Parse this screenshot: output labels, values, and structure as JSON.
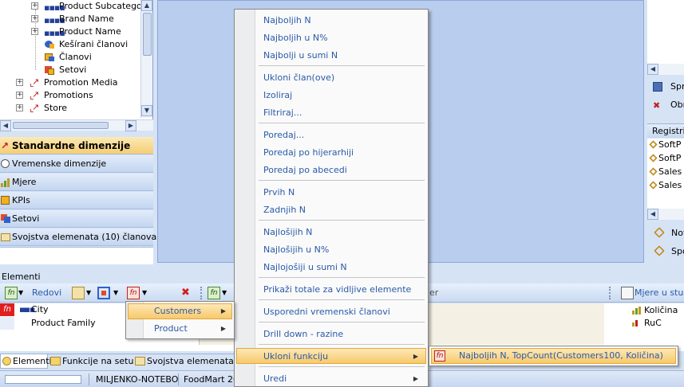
{
  "tree": {
    "items": [
      {
        "label": "Product Subcategory",
        "indent": 2,
        "icon": "hierarchy-level-icon"
      },
      {
        "label": "Brand Name",
        "indent": 2,
        "icon": "hierarchy-level-icon"
      },
      {
        "label": "Product Name",
        "indent": 2,
        "icon": "hierarchy-level-icon"
      },
      {
        "label": "Kešírani članovi",
        "indent": 2,
        "icon": "cached-members-icon"
      },
      {
        "label": "Članovi",
        "indent": 2,
        "icon": "members-icon"
      },
      {
        "label": "Setovi",
        "indent": 2,
        "icon": "sets-icon"
      },
      {
        "label": "Promotion Media",
        "indent": 1,
        "icon": "dimension-icon"
      },
      {
        "label": "Promotions",
        "indent": 1,
        "icon": "dimension-icon"
      },
      {
        "label": "Store",
        "indent": 1,
        "icon": "dimension-icon"
      }
    ]
  },
  "categories": [
    {
      "label": "Standardne dimenzije",
      "active": true
    },
    {
      "label": "Vremenske dimenzije",
      "active": false
    },
    {
      "label": "Mjere",
      "active": false
    },
    {
      "label": "KPIs",
      "active": false
    },
    {
      "label": "Setovi",
      "active": false
    },
    {
      "label": "Svojstva elemenata (10)  članova",
      "active": false
    }
  ],
  "right_panel": {
    "spr": "Spr",
    "obr": "Obr",
    "registri": "Registri",
    "list": [
      "SoftP",
      "SoftP",
      "Sales",
      "Sales"
    ],
    "nov": "Nov",
    "spo": "Spo"
  },
  "elementi": {
    "section_label": "Elementi",
    "toolbar_redovi": "Redovi",
    "toolbar_er": "er",
    "toolbar_mjere": "Mjere u stup",
    "rows": [
      {
        "tag": "fn",
        "label": "City",
        "indent": 1
      },
      {
        "tag": "",
        "label": "Product Family",
        "indent": 2
      }
    ],
    "measures": [
      "Količina",
      "RuC"
    ]
  },
  "tabs": [
    {
      "label": "Elementi"
    },
    {
      "label": "Funkcije na setu"
    },
    {
      "label": "Svojstva elemenata"
    }
  ],
  "status": {
    "machine": "MILJENKO-NOTEBO",
    "db": "FoodMart 20"
  },
  "context_menu": {
    "groups": [
      [
        "Najboljih N",
        "Najboljih u N%",
        "Najbolji u sumi N"
      ],
      [
        "Ukloni član(ove)",
        "Izoliraj",
        "Filtriraj..."
      ],
      [
        "Poredaj...",
        "Poredaj po hijerarhiji",
        "Poredaj po abecedi"
      ],
      [
        "Prvih N",
        "Zadnjih N"
      ],
      [
        "Najlošijih N",
        "Najlošijih u N%",
        "Najlojošiji u sumi N"
      ],
      [
        "Prikaži totale za vidljive elemente"
      ],
      [
        "Usporedni vremenski članovi"
      ],
      [
        "Drill down - razine"
      ],
      [
        "Ukloni funkciju"
      ],
      [
        "Uredi"
      ]
    ],
    "highlighted": "Ukloni funkciju"
  },
  "submenu_dim": {
    "items": [
      "Customers",
      "Product"
    ],
    "highlighted": "Customers"
  },
  "submenu_func": {
    "item": "Najboljih N, TopCount(Customers100, Količina)"
  },
  "colors": {
    "accent_blue": "#2a5aa8",
    "highlight": "#f7c96b",
    "canvas": "#b9cdee"
  }
}
